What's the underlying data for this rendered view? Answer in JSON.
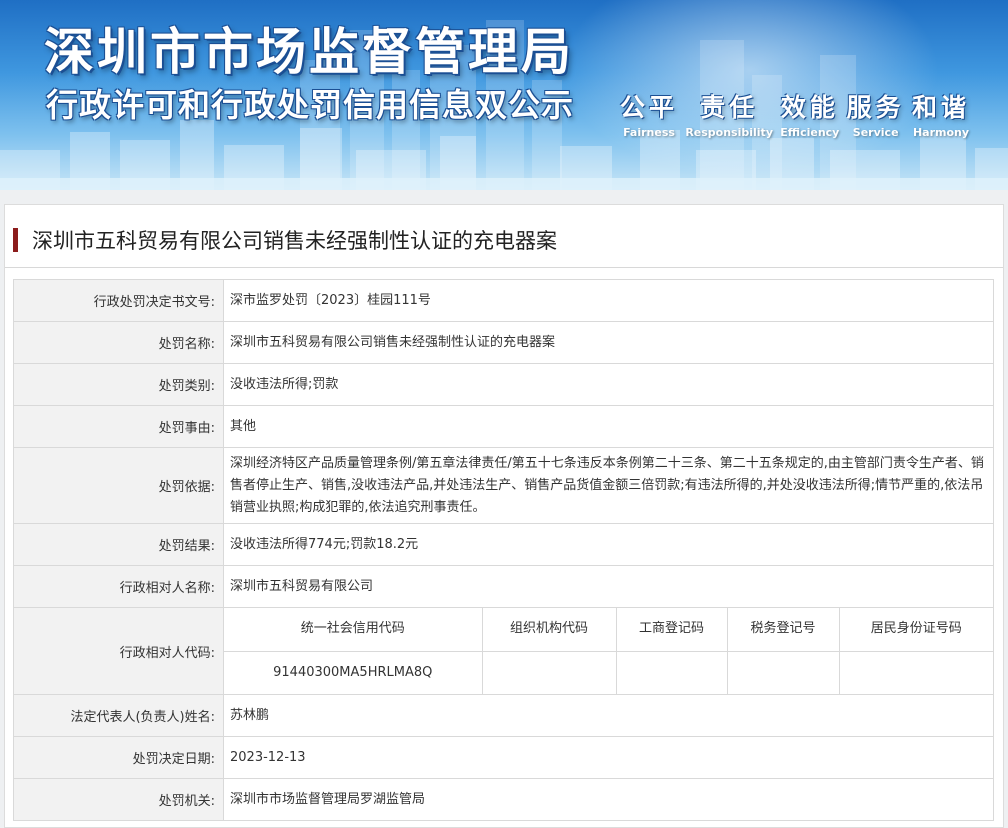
{
  "banner": {
    "title": "深圳市市场监督管理局",
    "subtitle": "行政许可和行政处罚信用信息双公示",
    "values": [
      {
        "cn": "公平",
        "en": "Fairness"
      },
      {
        "cn": "责任",
        "en": "Responsibility"
      },
      {
        "cn": "效能",
        "en": "Efficiency"
      },
      {
        "cn": "服务",
        "en": "Service"
      },
      {
        "cn": "和谐",
        "en": "Harmony"
      }
    ]
  },
  "case": {
    "title": "深圳市五科贸易有限公司销售未经强制性认证的充电器案"
  },
  "details": {
    "decision_no_label": "行政处罚决定书文号:",
    "decision_no": "深市监罗处罚〔2023〕桂园111号",
    "name_label": "处罚名称:",
    "name": "深圳市五科贸易有限公司销售未经强制性认证的充电器案",
    "type_label": "处罚类别:",
    "type": "没收违法所得;罚款",
    "reason_label": "处罚事由:",
    "reason": "其他",
    "basis_label": "处罚依据:",
    "basis": "深圳经济特区产品质量管理条例/第五章法律责任/第五十七条违反本条例第二十三条、第二十五条规定的,由主管部门责令生产者、销售者停止生产、销售,没收违法产品,并处违法生产、销售产品货值金额三倍罚款;有违法所得的,并处没收违法所得;情节严重的,依法吊销营业执照;构成犯罪的,依法追究刑事责任。",
    "result_label": "处罚结果:",
    "result": "没收违法所得774元;罚款18.2元",
    "party_label": "行政相对人名称:",
    "party": "深圳市五科贸易有限公司",
    "codes_label": "行政相对人代码:",
    "codes": {
      "headers": [
        "统一社会信用代码",
        "组织机构代码",
        "工商登记码",
        "税务登记号",
        "居民身份证号码"
      ],
      "values": [
        "91440300MA5HRLMA8Q",
        "",
        "",
        "",
        ""
      ]
    },
    "rep_label": "法定代表人(负责人)姓名:",
    "rep": "苏林鹏",
    "date_label": "处罚决定日期:",
    "date": "2023-12-13",
    "authority_label": "处罚机关:",
    "authority": "深圳市市场监督管理局罗湖监管局"
  }
}
